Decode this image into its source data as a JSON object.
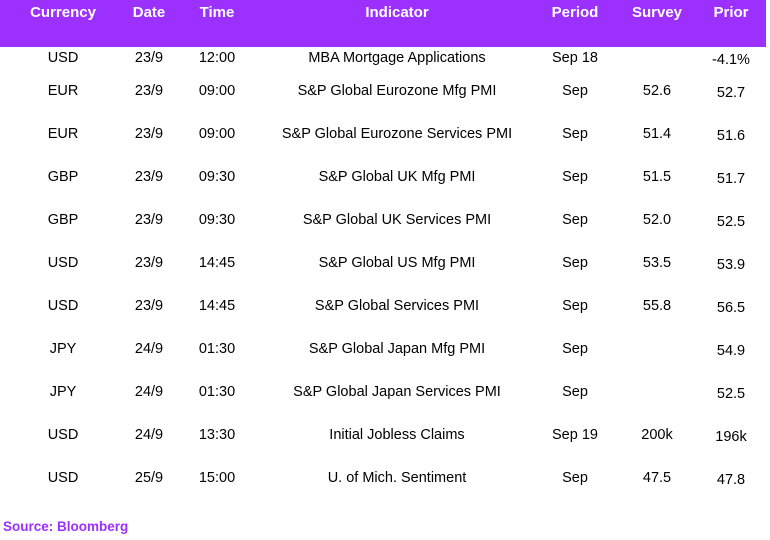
{
  "table": {
    "headers": {
      "currency": "Currency",
      "date": "Date",
      "time": "Time",
      "indicator": "Indicator",
      "period": "Period",
      "survey": "Survey",
      "prior": "Prior"
    },
    "rows": [
      {
        "currency": "USD",
        "date": "23/9",
        "time": "12:00",
        "indicator": "MBA Mortgage Applications",
        "period": "Sep 18",
        "survey": "",
        "prior": "-4.1%"
      },
      {
        "currency": "EUR",
        "date": "23/9",
        "time": "09:00",
        "indicator": "S&P Global Eurozone Mfg PMI",
        "period": "Sep",
        "survey": "52.6",
        "prior": "52.7"
      },
      {
        "currency": "EUR",
        "date": "23/9",
        "time": "09:00",
        "indicator": "S&P Global Eurozone Services PMI",
        "period": "Sep",
        "survey": "51.4",
        "prior": "51.6"
      },
      {
        "currency": "GBP",
        "date": "23/9",
        "time": "09:30",
        "indicator": "S&P Global UK Mfg PMI",
        "period": "Sep",
        "survey": "51.5",
        "prior": "51.7"
      },
      {
        "currency": "GBP",
        "date": "23/9",
        "time": "09:30",
        "indicator": "S&P Global UK Services PMI",
        "period": "Sep",
        "survey": "52.0",
        "prior": "52.5"
      },
      {
        "currency": "USD",
        "date": "23/9",
        "time": "14:45",
        "indicator": "S&P Global US Mfg PMI",
        "period": "Sep",
        "survey": "53.5",
        "prior": "53.9"
      },
      {
        "currency": "USD",
        "date": "23/9",
        "time": "14:45",
        "indicator": "S&P Global Services PMI",
        "period": "Sep",
        "survey": "55.8",
        "prior": "56.5"
      },
      {
        "currency": "JPY",
        "date": "24/9",
        "time": "01:30",
        "indicator": "S&P Global Japan Mfg PMI",
        "period": "Sep",
        "survey": "",
        "prior": "54.9"
      },
      {
        "currency": "JPY",
        "date": "24/9",
        "time": "01:30",
        "indicator": "S&P Global Japan Services PMI",
        "period": "Sep",
        "survey": "",
        "prior": "52.5"
      },
      {
        "currency": "USD",
        "date": "24/9",
        "time": "13:30",
        "indicator": "Initial Jobless Claims",
        "period": "Sep 19",
        "survey": "200k",
        "prior": "196k"
      },
      {
        "currency": "USD",
        "date": "25/9",
        "time": "15:00",
        "indicator": "U. of Mich. Sentiment",
        "period": "Sep",
        "survey": "47.5",
        "prior": "47.8"
      }
    ]
  },
  "footer": {
    "source": "Source: Bloomberg"
  },
  "colors": {
    "header_bg": "#9b30ff",
    "header_text": "#ffffff",
    "source_text": "#9b30ff"
  }
}
